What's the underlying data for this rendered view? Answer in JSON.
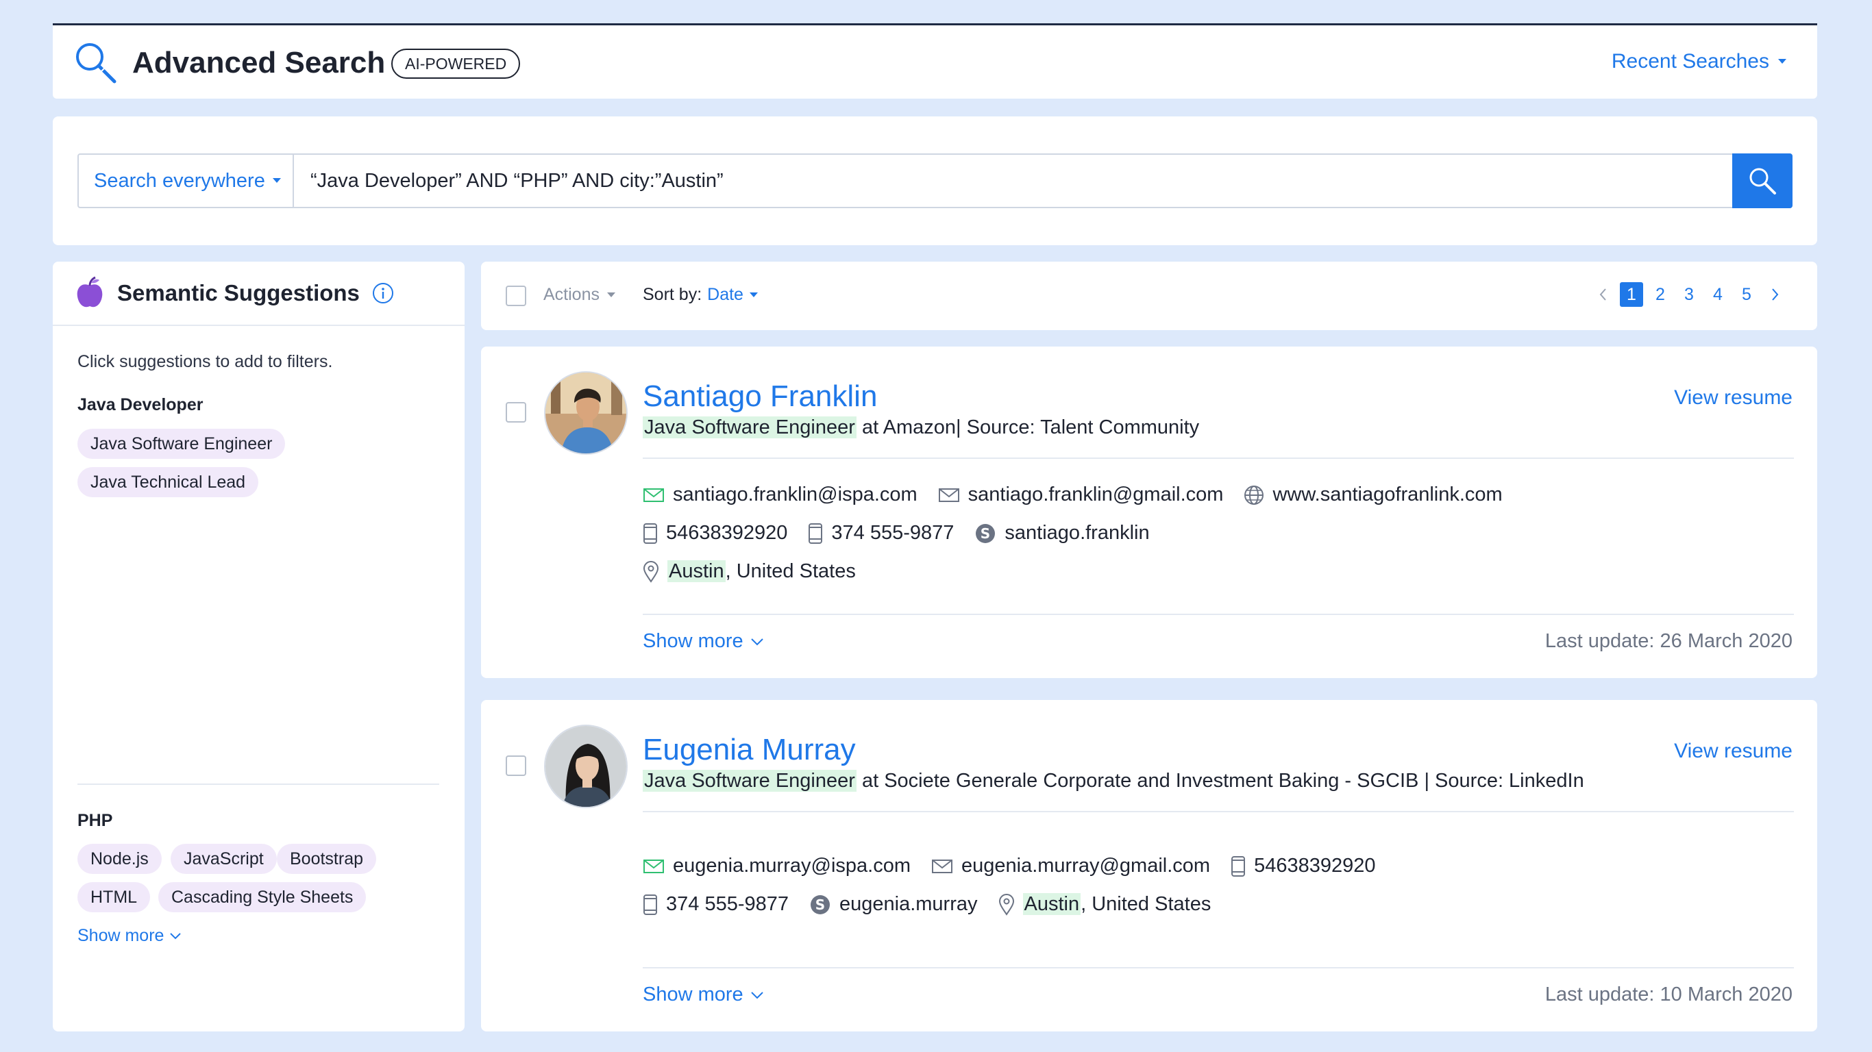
{
  "header": {
    "title": "Advanced Search",
    "badge": "AI-POWERED",
    "recent_searches": "Recent Searches"
  },
  "search": {
    "scope": "Search everywhere",
    "query": "“Java Developer” AND “PHP” AND city:”Austin”",
    "button_icon": "search-icon"
  },
  "suggestions": {
    "title": "Semantic Suggestions",
    "hint": "Click suggestions to add to filters.",
    "groups": [
      {
        "title": "Java Developer",
        "chips": [
          "Java Software Engineer",
          "Java Technical Lead"
        ]
      },
      {
        "title": "PHP",
        "chips": [
          "Node.js",
          "JavaScript",
          "Bootstrap",
          "HTML",
          "Cascading Style Sheets"
        ]
      }
    ],
    "show_more": "Show more",
    "chip_color": "#f1e9fa"
  },
  "toolbar": {
    "actions": "Actions",
    "sort_label": "Sort by:",
    "sort_value": "Date",
    "pages": [
      "1",
      "2",
      "3",
      "4",
      "5"
    ],
    "current_page": "1"
  },
  "candidates": [
    {
      "name": "Santiago Franklin",
      "view_resume": "View resume",
      "title": "Java Software Engineer",
      "at_text": " at Amazon",
      "source": " Source: Talent Community",
      "email_work": "santiago.franklin@ispa.com",
      "email_personal": "santiago.franklin@gmail.com",
      "website": "www.santiagofranlink.com",
      "phone_1": "54638392920",
      "phone_2": "374 555-9877",
      "skype": "santiago.franklin",
      "city": "Austin",
      "country": ", United States",
      "show_more": "Show more",
      "last_update": "Last update: 26 March 2020"
    },
    {
      "name": "Eugenia Murray",
      "view_resume": "View resume",
      "title": "Java Software Engineer",
      "at_text": " at Societe Generale Corporate and Investment Baking - SGCIB ",
      "source": " Source: LinkedIn",
      "email_work": "eugenia.murray@ispa.com",
      "email_personal": "eugenia.murray@gmail.com",
      "phone_1": "54638392920",
      "phone_2": "374 555-9877",
      "skype": "eugenia.murray",
      "city": "Austin",
      "country": ", United States",
      "show_more": "Show more",
      "last_update": "Last update: 10 March 2020"
    }
  ],
  "colors": {
    "accent": "#1f78e8",
    "highlight": "#dcf5e4",
    "background": "#dde9fb",
    "email_icon": "#2fbf71",
    "apple_icon": "#8b4fd6"
  }
}
